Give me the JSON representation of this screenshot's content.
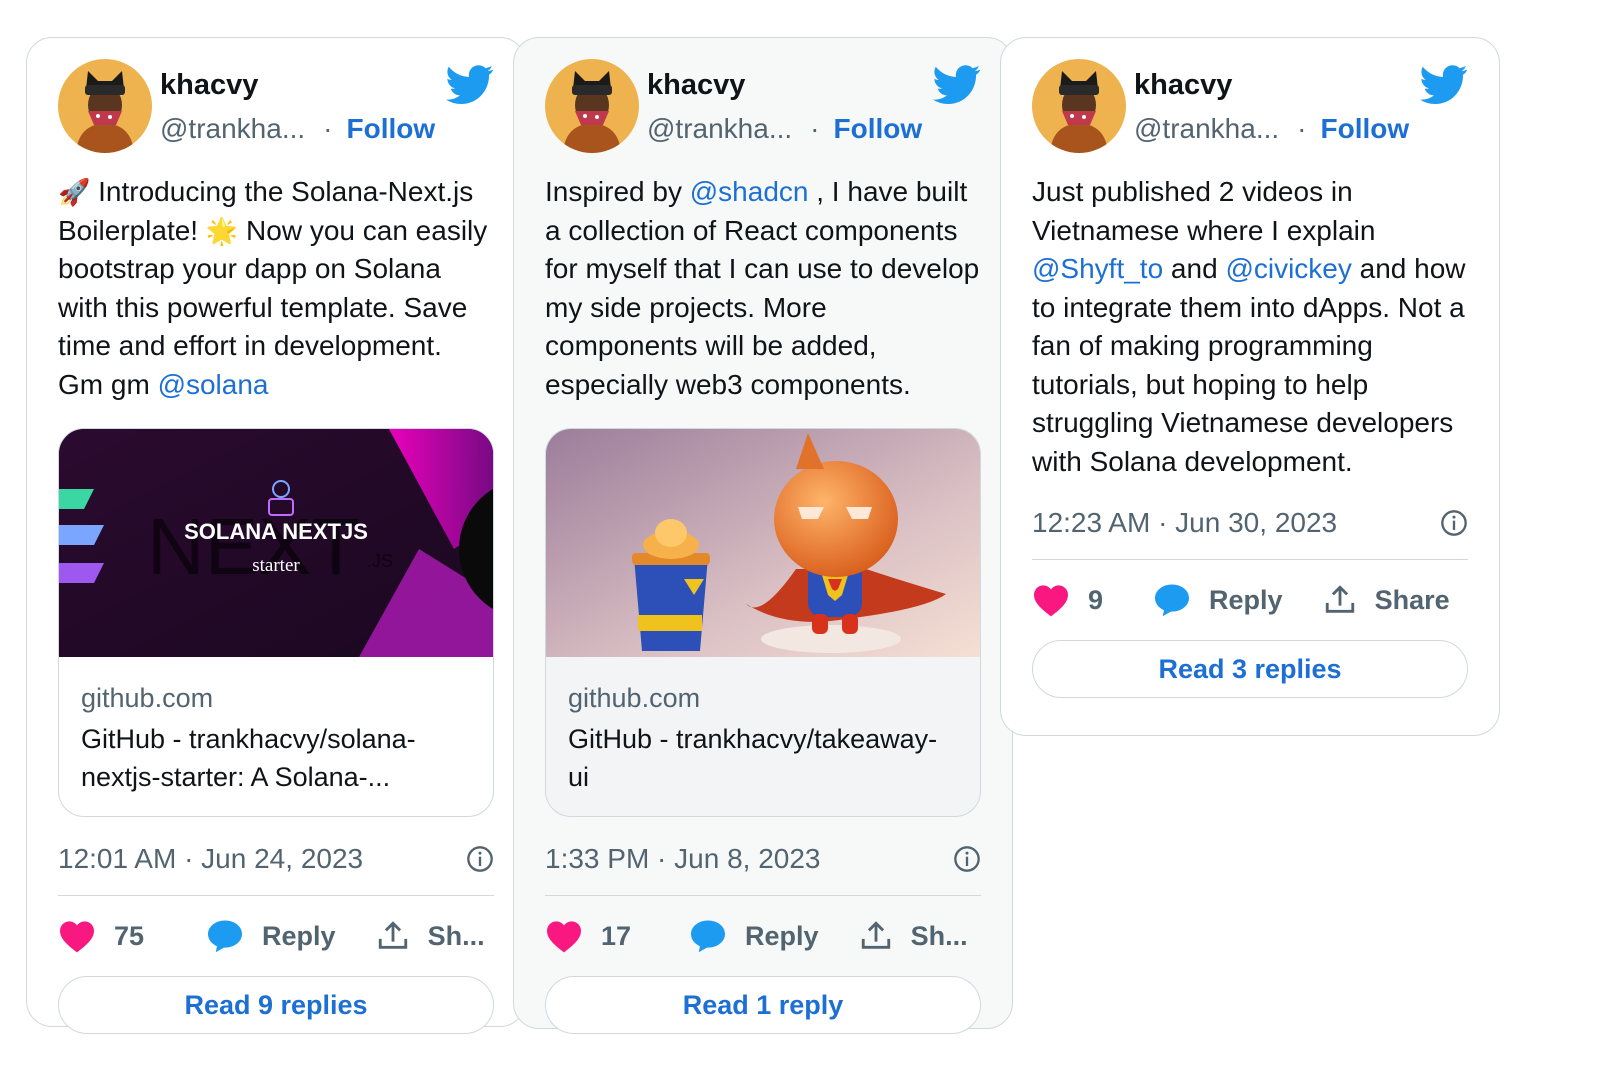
{
  "tweets": [
    {
      "name": "khacvy",
      "handle": "@trankha...",
      "dot": "·",
      "follow": "Follow",
      "text": {
        "p1": "🚀",
        "p2": " Introducing the Solana-Next.js Boilerplate! ",
        "p3": "🌟",
        "p4": " Now you can easily bootstrap your dapp on Solana with this powerful template. Save time and effort in development. Gm gm ",
        "mention": "@solana"
      },
      "link": {
        "image_title": "SOLANA NEXTJS",
        "image_sub": "starter",
        "image_js": ".JS",
        "domain": "github.com",
        "title": "GitHub - trankhacvy/solana-nextjs-starter: A Solana-..."
      },
      "time": "12:01 AM · Jun 24, 2023",
      "likes": "75",
      "reply": "Reply",
      "share": "Sh...",
      "read": "Read 9 replies"
    },
    {
      "name": "khacvy",
      "handle": "@trankha...",
      "dot": "·",
      "follow": "Follow",
      "text": {
        "p1": "Inspired by ",
        "mention": "@shadcn",
        "p2": " , I have built a collection of React components for myself that I can use to develop my side projects. More components will be added, especially web3 components."
      },
      "link": {
        "domain": "github.com",
        "title": "GitHub - trankhacvy/takeaway-ui"
      },
      "time": "1:33 PM · Jun 8, 2023",
      "likes": "17",
      "reply": "Reply",
      "share": "Sh...",
      "read": "Read 1 reply"
    },
    {
      "name": "khacvy",
      "handle": "@trankha...",
      "dot": "·",
      "follow": "Follow",
      "text": {
        "p1": "Just published 2 videos in Vietnamese where I explain ",
        "mention1": "@Shyft_to",
        "p2": "  and ",
        "mention2": "@civickey",
        "p3": "  and how to integrate them into dApps. Not a fan of making programming tutorials, but hoping to help struggling Vietnamese developers with Solana development."
      },
      "time": "12:23 AM · Jun 30, 2023",
      "likes": "9",
      "reply": "Reply",
      "share": "Share",
      "read": "Read 3 replies"
    }
  ],
  "colors": {
    "accent": "#1d6fd4",
    "heart": "#f91880",
    "reply_bubble": "#1d9bf0",
    "muted": "#536471",
    "border": "#cfd9de"
  },
  "icons": [
    "twitter-bird-icon",
    "heart-icon",
    "reply-bubble-icon",
    "share-icon",
    "info-icon"
  ]
}
